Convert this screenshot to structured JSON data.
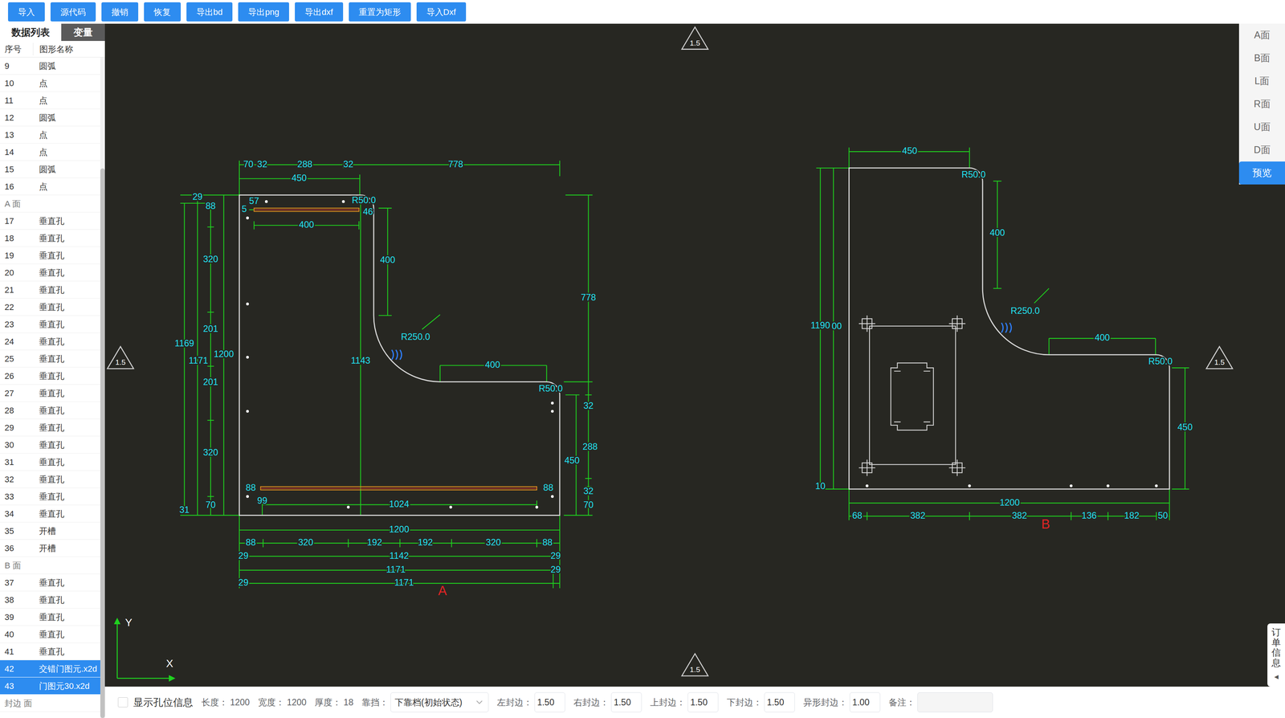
{
  "toolbar": {
    "buttons": [
      "导入",
      "源代码",
      "撤销",
      "恢复",
      "导出bd",
      "导出png",
      "导出dxf",
      "重置为矩形",
      "导入Dxf"
    ]
  },
  "sidebar": {
    "tabs": [
      {
        "label": "数据列表",
        "selected": true
      },
      {
        "label": "变量",
        "selected": false
      }
    ],
    "columns": [
      "序号",
      "图形名称"
    ],
    "rows": [
      {
        "kind": "item",
        "index": "9",
        "name": "圆弧",
        "selected": false
      },
      {
        "kind": "item",
        "index": "10",
        "name": "点",
        "selected": false
      },
      {
        "kind": "item",
        "index": "11",
        "name": "点",
        "selected": false
      },
      {
        "kind": "item",
        "index": "12",
        "name": "圆弧",
        "selected": false
      },
      {
        "kind": "item",
        "index": "13",
        "name": "点",
        "selected": false
      },
      {
        "kind": "item",
        "index": "14",
        "name": "点",
        "selected": false
      },
      {
        "kind": "item",
        "index": "15",
        "name": "圆弧",
        "selected": false
      },
      {
        "kind": "item",
        "index": "16",
        "name": "点",
        "selected": false
      },
      {
        "kind": "group",
        "index": "",
        "name": "A 面",
        "selected": false
      },
      {
        "kind": "item",
        "index": "17",
        "name": "垂直孔",
        "selected": false
      },
      {
        "kind": "item",
        "index": "18",
        "name": "垂直孔",
        "selected": false
      },
      {
        "kind": "item",
        "index": "19",
        "name": "垂直孔",
        "selected": false
      },
      {
        "kind": "item",
        "index": "20",
        "name": "垂直孔",
        "selected": false
      },
      {
        "kind": "item",
        "index": "21",
        "name": "垂直孔",
        "selected": false
      },
      {
        "kind": "item",
        "index": "22",
        "name": "垂直孔",
        "selected": false
      },
      {
        "kind": "item",
        "index": "23",
        "name": "垂直孔",
        "selected": false
      },
      {
        "kind": "item",
        "index": "24",
        "name": "垂直孔",
        "selected": false
      },
      {
        "kind": "item",
        "index": "25",
        "name": "垂直孔",
        "selected": false
      },
      {
        "kind": "item",
        "index": "26",
        "name": "垂直孔",
        "selected": false
      },
      {
        "kind": "item",
        "index": "27",
        "name": "垂直孔",
        "selected": false
      },
      {
        "kind": "item",
        "index": "28",
        "name": "垂直孔",
        "selected": false
      },
      {
        "kind": "item",
        "index": "29",
        "name": "垂直孔",
        "selected": false
      },
      {
        "kind": "item",
        "index": "30",
        "name": "垂直孔",
        "selected": false
      },
      {
        "kind": "item",
        "index": "31",
        "name": "垂直孔",
        "selected": false
      },
      {
        "kind": "item",
        "index": "32",
        "name": "垂直孔",
        "selected": false
      },
      {
        "kind": "item",
        "index": "33",
        "name": "垂直孔",
        "selected": false
      },
      {
        "kind": "item",
        "index": "34",
        "name": "垂直孔",
        "selected": false
      },
      {
        "kind": "item",
        "index": "35",
        "name": "开槽",
        "selected": false
      },
      {
        "kind": "item",
        "index": "36",
        "name": "开槽",
        "selected": false
      },
      {
        "kind": "group",
        "index": "",
        "name": "B 面",
        "selected": false
      },
      {
        "kind": "item",
        "index": "37",
        "name": "垂直孔",
        "selected": false
      },
      {
        "kind": "item",
        "index": "38",
        "name": "垂直孔",
        "selected": false
      },
      {
        "kind": "item",
        "index": "39",
        "name": "垂直孔",
        "selected": false
      },
      {
        "kind": "item",
        "index": "40",
        "name": "垂直孔",
        "selected": false
      },
      {
        "kind": "item",
        "index": "41",
        "name": "垂直孔",
        "selected": false
      },
      {
        "kind": "item",
        "index": "42",
        "name": "交错门图元.x2d",
        "selected": true
      },
      {
        "kind": "item",
        "index": "43",
        "name": "门图元30.x2d",
        "selected": true
      },
      {
        "kind": "group",
        "index": "",
        "name": "封边 面",
        "selected": false
      }
    ]
  },
  "canvas": {
    "markers": [
      "1.5",
      "1.5",
      "1.5",
      "1.5"
    ],
    "axes": {
      "x": "X",
      "y": "Y"
    },
    "parts": [
      {
        "label": "A",
        "dimensions": [
          "70",
          "32",
          "288",
          "32",
          "778",
          "450",
          "29",
          "88",
          "57",
          "5",
          "R50.0",
          "46",
          "400",
          "320",
          "400",
          "778",
          "201",
          "R250.0",
          "1169",
          "1171",
          "1200",
          "1143",
          "400",
          "201",
          "R50.0",
          "32",
          "288",
          "450",
          "320",
          "88",
          "88",
          "32",
          "99",
          "1024",
          "70",
          "70",
          "31",
          "1200",
          "88",
          "320",
          "192",
          "192",
          "320",
          "88",
          "29",
          "1142",
          "29",
          "1171",
          "29",
          "29",
          "1171"
        ]
      },
      {
        "label": "B",
        "dimensions": [
          "450",
          "R50.0",
          "400",
          "R250.0",
          "1190",
          "00",
          "400",
          "R50.0",
          "450",
          "10",
          "1200",
          "68",
          "382",
          "382",
          "136",
          "182",
          "50"
        ]
      }
    ]
  },
  "view_panel": {
    "items": [
      {
        "label": "A面",
        "selected": false
      },
      {
        "label": "B面",
        "selected": false
      },
      {
        "label": "L面",
        "selected": false
      },
      {
        "label": "R面",
        "selected": false
      },
      {
        "label": "U面",
        "selected": false
      },
      {
        "label": "D面",
        "selected": false
      },
      {
        "label": "预览",
        "selected": true
      }
    ]
  },
  "order_tab": {
    "label": "订单信息",
    "icon": "◂"
  },
  "status_bar": {
    "show_holes": {
      "label": "显示孔位信息",
      "checked": false
    },
    "fields": [
      {
        "kind": "text",
        "label": "长度：",
        "value": "1200"
      },
      {
        "kind": "text",
        "label": "宽度：",
        "value": "1200"
      },
      {
        "kind": "text",
        "label": "厚度：",
        "value": "18"
      },
      {
        "kind": "select",
        "label": "靠挡：",
        "value": "下靠档(初始状态)"
      },
      {
        "kind": "input",
        "label": "左封边：",
        "value": "1.50"
      },
      {
        "kind": "input",
        "label": "右封边：",
        "value": "1.50"
      },
      {
        "kind": "input",
        "label": "上封边：",
        "value": "1.50"
      },
      {
        "kind": "input",
        "label": "下封边：",
        "value": "1.50"
      },
      {
        "kind": "input",
        "label": "异形封边：",
        "value": "1.00"
      },
      {
        "kind": "input",
        "label": "备注：",
        "value": ""
      }
    ]
  }
}
